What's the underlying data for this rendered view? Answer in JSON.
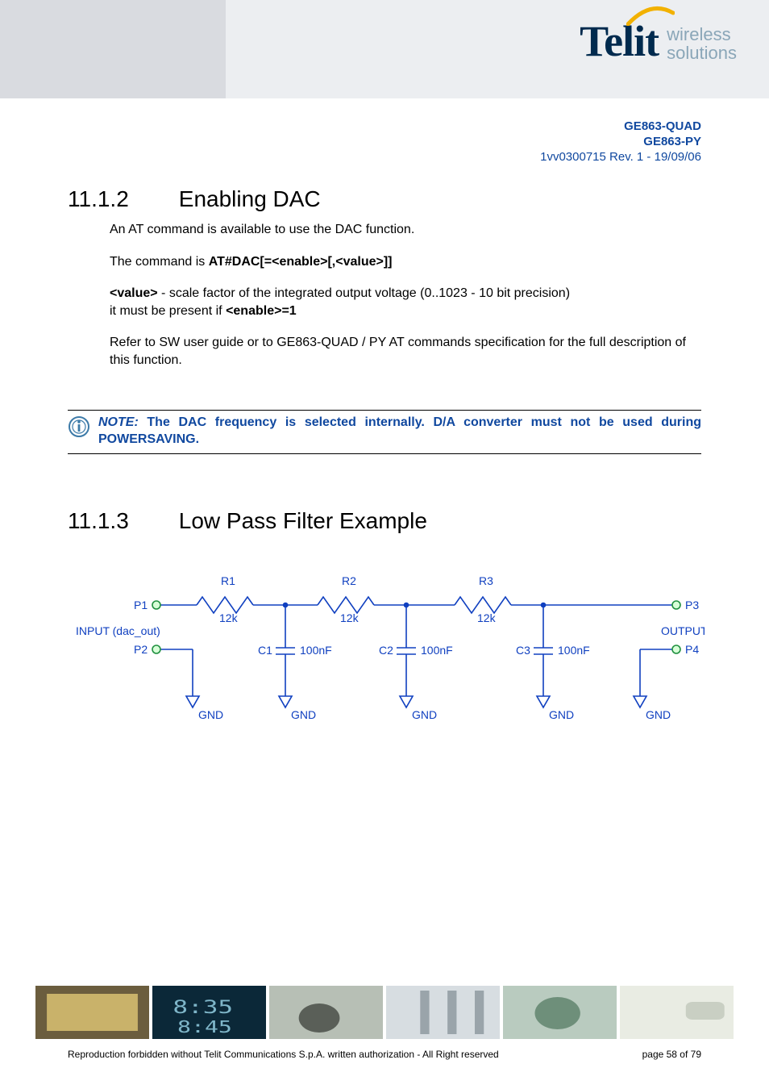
{
  "logo": {
    "name": "Telit",
    "tag_line1": "wireless",
    "tag_line2": "solutions"
  },
  "header": {
    "product1": "GE863-QUAD",
    "product2": "GE863-PY",
    "revision": "1vv0300715 Rev. 1 - 19/09/06"
  },
  "s1": {
    "num": "11.1.2",
    "title": "Enabling DAC",
    "p1": "An AT command is available to use the DAC function.",
    "p2a": "The command is ",
    "p2b": "AT#DAC[=<enable>[,<value>]]",
    "p3a": "<value>",
    "p3b": " - scale factor of the integrated output voltage (0..1023 - 10 bit precision)",
    "p3c": "it must be present if ",
    "p3d": "<enable>=1",
    "p4": "Refer to SW user guide or to GE863-QUAD / PY AT commands specification for the full description of this function."
  },
  "note": {
    "label": "NOTE:",
    "text": " The DAC frequency is selected internally. D/A converter must not be used during POWERSAVING."
  },
  "s2": {
    "num": "11.1.3",
    "title": "Low Pass Filter Example"
  },
  "circuit": {
    "input_label": "INPUT (dac_out)",
    "output_label": "OUTPUT",
    "P1": "P1",
    "P2": "P2",
    "P3": "P3",
    "P4": "P4",
    "R1": "R1",
    "R2": "R2",
    "R3": "R3",
    "Rval": "12k",
    "C1": "C1",
    "C2": "C2",
    "C3": "C3",
    "Cval": "100nF",
    "gnd": "GND"
  },
  "footer": {
    "copyright": "Reproduction forbidden without Telit Communications S.p.A. written authorization - All Right reserved",
    "page": "page 58 of 79"
  }
}
